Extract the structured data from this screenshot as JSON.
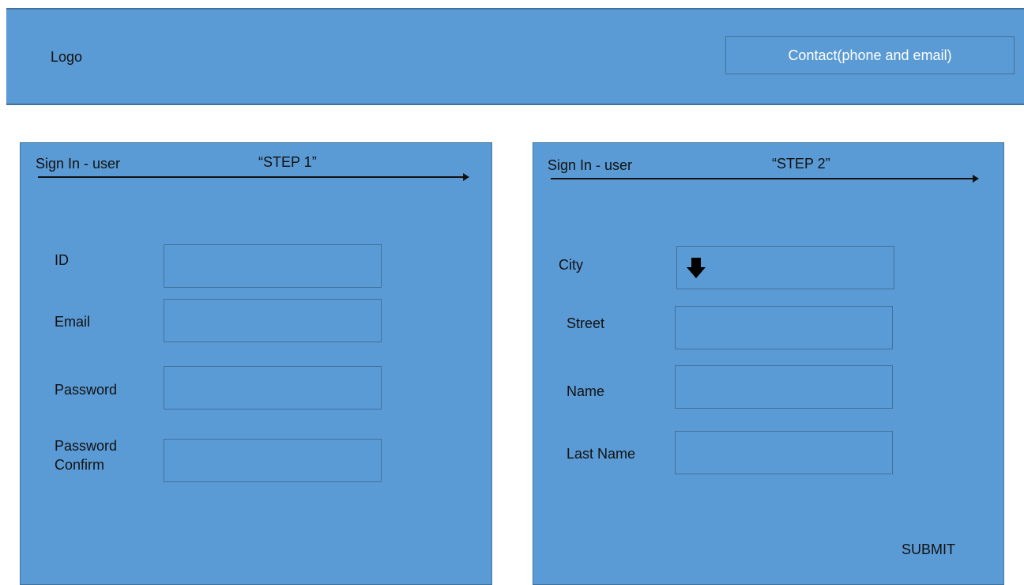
{
  "header": {
    "logo": "Logo",
    "contact": "Contact(phone and email)"
  },
  "step1": {
    "title": "Sign In - user",
    "step": "“STEP 1”",
    "fields": {
      "id": "ID",
      "email": "Email",
      "password": "Password",
      "password_confirm_line1": "Password",
      "password_confirm_line2": "Confirm"
    }
  },
  "step2": {
    "title": "Sign In - user",
    "step": "“STEP 2”",
    "fields": {
      "city": "City",
      "street": "Street",
      "name": "Name",
      "last_name": "Last Name"
    },
    "submit": "SUBMIT"
  },
  "icons": {
    "city_dropdown": "arrow-down-icon"
  },
  "colors": {
    "panel_fill": "#5b9bd5",
    "panel_border": "#41719c"
  }
}
